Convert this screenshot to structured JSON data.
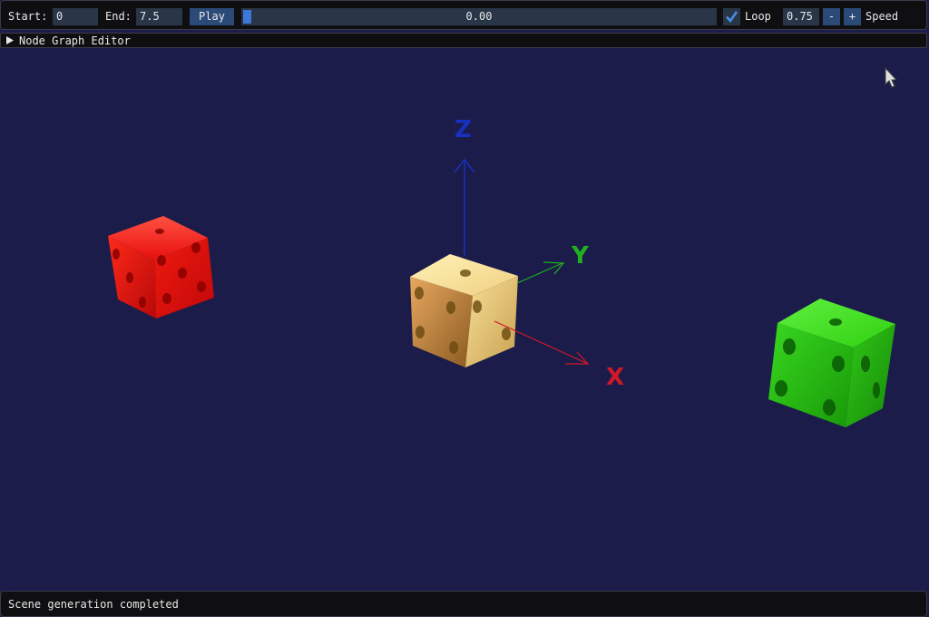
{
  "toolbar": {
    "start_label": "Start:",
    "start_value": "0",
    "end_label": "End:",
    "end_value": "7.5",
    "play_label": "Play",
    "progress_text": "0.00",
    "progress_fraction": 0.02,
    "loop_checked": true,
    "loop_label": "Loop",
    "speed_value": "0.75",
    "minus_label": "-",
    "plus_label": "+",
    "speed_label": "Speed"
  },
  "node_editor": {
    "collapsed": true,
    "title": "Node Graph Editor"
  },
  "scene": {
    "background": "#1c1c4a",
    "axes": {
      "x_label": "X",
      "y_label": "Y",
      "z_label": "Z"
    },
    "colors": {
      "x": "#d01828",
      "y": "#20b020",
      "z": "#1830c0"
    },
    "dice": [
      {
        "name": "red",
        "color": "#e01010"
      },
      {
        "name": "cream",
        "color": "#e8c070"
      },
      {
        "name": "green",
        "color": "#20c010"
      }
    ]
  },
  "status": {
    "message": "Scene generation completed"
  }
}
